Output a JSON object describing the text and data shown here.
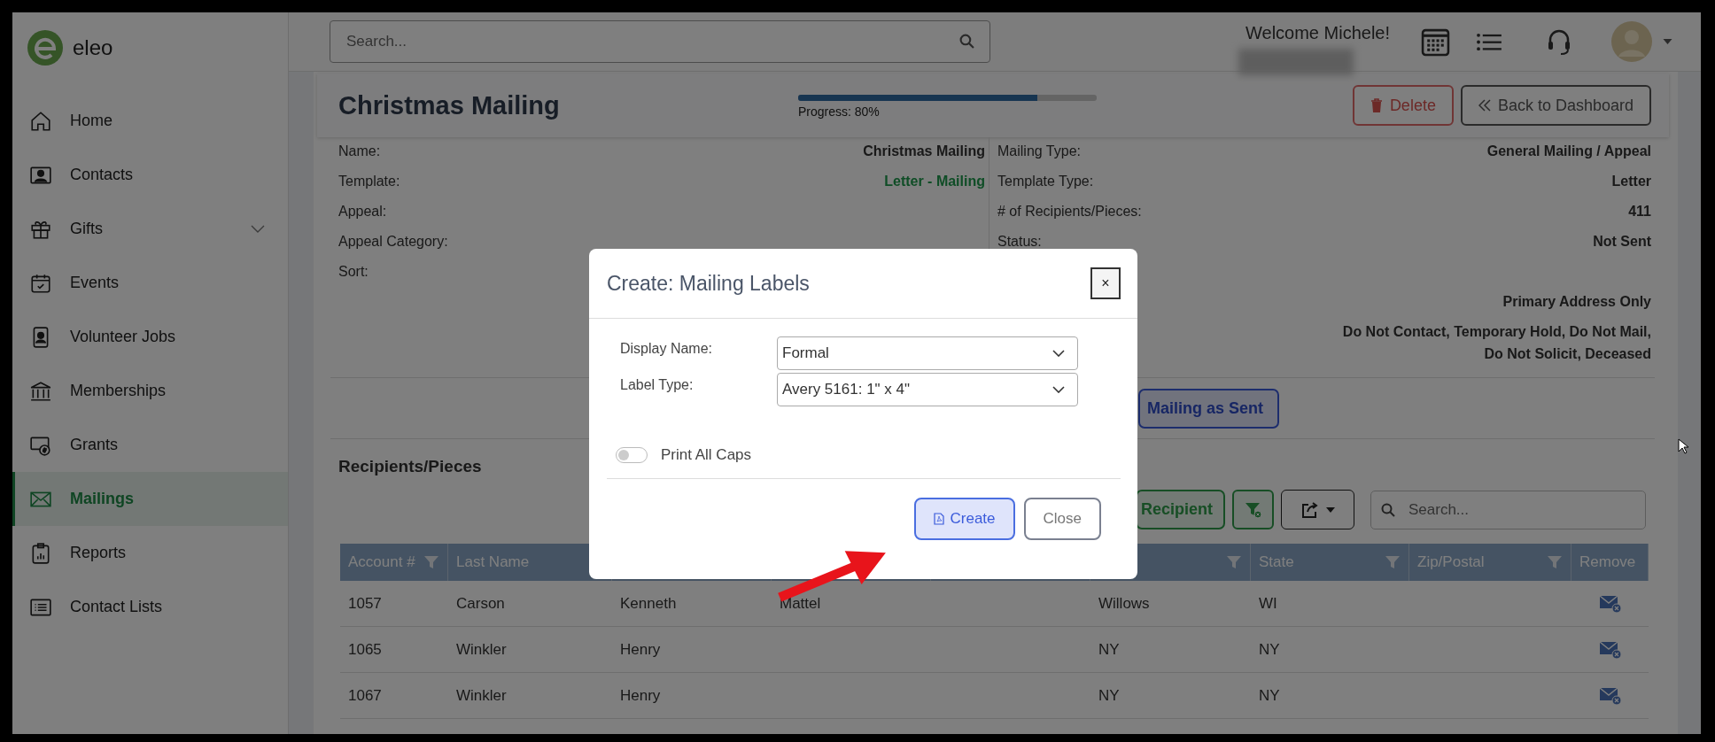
{
  "brand": {
    "name": "eleo"
  },
  "header": {
    "search_placeholder": "Search...",
    "welcome": "Welcome Michele!"
  },
  "sidebar": {
    "items": [
      {
        "label": "Home",
        "kind": "link",
        "selected": false
      },
      {
        "label": "Contacts",
        "kind": "link",
        "selected": false
      },
      {
        "label": "Gifts",
        "kind": "group",
        "expanded": false,
        "selected": false
      },
      {
        "label": "Events",
        "kind": "link",
        "selected": false
      },
      {
        "label": "Volunteer Jobs",
        "kind": "link",
        "selected": false
      },
      {
        "label": "Memberships",
        "kind": "link",
        "selected": false
      },
      {
        "label": "Grants",
        "kind": "link",
        "selected": false
      },
      {
        "label": "Mailings",
        "kind": "link",
        "selected": true
      },
      {
        "label": "Reports",
        "kind": "link",
        "selected": false
      },
      {
        "label": "Contact Lists",
        "kind": "link",
        "selected": false
      }
    ]
  },
  "mailing": {
    "title": "Christmas Mailing",
    "progress": {
      "level": 0.8,
      "label": "Progress: 80%"
    },
    "buttons": [
      {
        "label": "Delete",
        "kind": "danger"
      },
      {
        "label": "Back to Dashboard",
        "kind": "back"
      }
    ]
  },
  "details": {
    "left": [
      {
        "label": "Name:",
        "value": "Christmas Mailing",
        "kind": "text"
      },
      {
        "label": "Template:",
        "value": "Letter - Mailing",
        "kind": "link"
      },
      {
        "label": "Appeal:"
      },
      {
        "label": "Appeal Category:"
      },
      {
        "label": "Sort:"
      }
    ],
    "right": [
      {
        "label": "Mailing Type:",
        "value": "General Mailing / Appeal"
      },
      {
        "label": "Template Type:",
        "value": "Letter"
      },
      {
        "label": "# of Recipients/Pieces:",
        "value": "411"
      },
      {
        "label": "Status:",
        "value": "Not Sent"
      },
      {
        "value": "Primary Address Only"
      },
      {
        "value": "Do Not Contact, Temporary Hold, Do Not Mail, Do Not Solicit, Deceased"
      }
    ]
  },
  "mark_sent_button": "Mailing as Sent",
  "recipients": {
    "title": "Recipients/Pieces",
    "add_button": "Recipient",
    "search_placeholder": "Search...",
    "table": {
      "columns": [
        {
          "label": "Account #",
          "filter": true
        },
        {
          "label": "Last Name"
        },
        null,
        null,
        null,
        {
          "filter": true
        },
        {
          "label": "State",
          "filter": true
        },
        {
          "label": "Zip/Postal",
          "filter": true
        },
        {
          "label": "Remove"
        }
      ],
      "rows": [
        {
          "cells": [
            "1057",
            "Carson",
            "Kenneth",
            "Mattel",
            null,
            "Willows",
            "WI",
            null
          ]
        },
        {
          "cells": [
            "1065",
            "Winkler",
            "Henry",
            null,
            null,
            "NY",
            "NY",
            null
          ]
        },
        {
          "cells": [
            "1067",
            "Winkler",
            "Henry",
            null,
            null,
            "NY",
            "NY",
            null
          ]
        }
      ]
    }
  },
  "modal": {
    "title": "Create: Mailing Labels",
    "close": "×",
    "fields": [
      {
        "label": "Display Name:",
        "value": "Formal"
      },
      {
        "label": "Label Type:",
        "value": "Avery 5161: 1\" x 4\""
      }
    ],
    "toggle": {
      "label": "Print All Caps",
      "on": false
    },
    "buttons": [
      {
        "label": "Create",
        "kind": "primary"
      },
      {
        "label": "Close",
        "kind": "secondary"
      }
    ]
  }
}
